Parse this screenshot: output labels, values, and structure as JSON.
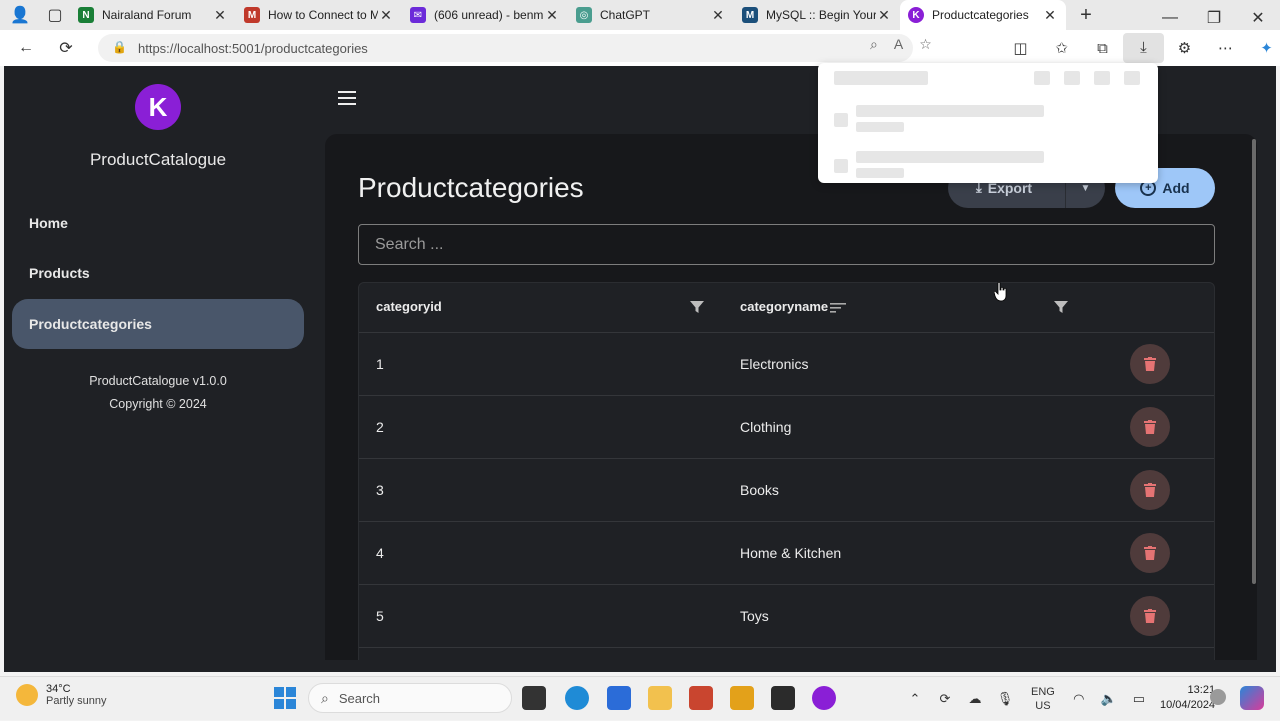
{
  "browser": {
    "tabs": [
      {
        "title": "Nairaland Forum",
        "color": "#1a7f37",
        "glyph": "N"
      },
      {
        "title": "How to Connect to M",
        "color": "#c0392b",
        "glyph": "M"
      },
      {
        "title": "(606 unread) - benm",
        "color": "#6c2bd9",
        "glyph": "✉"
      },
      {
        "title": "ChatGPT",
        "color": "#4a9d8f",
        "glyph": "◎"
      },
      {
        "title": "MySQL :: Begin Your",
        "color": "#1b4f7a",
        "glyph": "M"
      },
      {
        "title": "Productcategories",
        "color": "#8a1fd6",
        "glyph": "K"
      }
    ],
    "url": "https://localhost:5001/productcategories"
  },
  "sidebar": {
    "app_name": "ProductCatalogue",
    "logo_glyph": "K",
    "nav": [
      {
        "label": "Home"
      },
      {
        "label": "Products"
      },
      {
        "label": "Productcategories"
      }
    ],
    "version": "ProductCatalogue v1.0.0",
    "copyright": "Copyright © 2024"
  },
  "page": {
    "title": "Productcategories",
    "export_label": "Export",
    "add_label": "Add",
    "search_placeholder": "Search ...",
    "columns": [
      "categoryid",
      "categoryname"
    ],
    "rows": [
      {
        "id": "1",
        "name": "Electronics"
      },
      {
        "id": "2",
        "name": "Clothing"
      },
      {
        "id": "3",
        "name": "Books"
      },
      {
        "id": "4",
        "name": "Home & Kitchen"
      },
      {
        "id": "5",
        "name": "Toys"
      }
    ]
  },
  "taskbar": {
    "temperature": "34°C",
    "weather": "Partly sunny",
    "search_label": "Search",
    "lang1": "ENG",
    "lang2": "US",
    "time": "13:21",
    "date": "10/04/2024"
  },
  "colors": {
    "accent": "#9ec7f8",
    "brand": "#8a1fd6",
    "active_nav": "#49566a",
    "delete": "#e57373"
  }
}
